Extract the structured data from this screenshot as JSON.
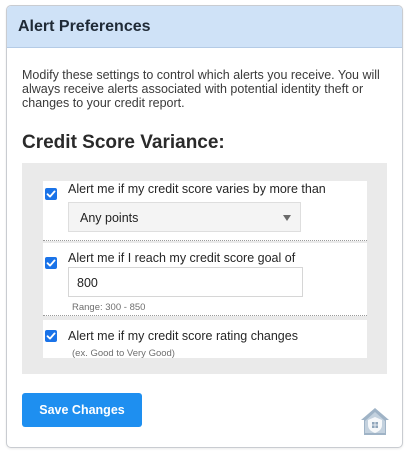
{
  "header": {
    "title": "Alert Preferences"
  },
  "intro": {
    "text": "Modify these settings to control which alerts you receive. You will always receive alerts associated with potential identity theft or changes to your credit report."
  },
  "section": {
    "title": "Credit Score Variance:"
  },
  "alerts": [
    {
      "checked": true,
      "label": "Alert me if my credit score varies by more than",
      "select": {
        "selected": "Any points"
      }
    },
    {
      "checked": true,
      "label": "Alert me if I reach my credit score goal of",
      "input": {
        "value": "800"
      },
      "hint": "Range: 300 - 850"
    },
    {
      "checked": true,
      "label": "Alert me if my credit score rating changes",
      "hint": "(ex. Good to Very Good)"
    }
  ],
  "footer": {
    "save_label": "Save Changes"
  },
  "colors": {
    "header_bg": "#cfe2f7",
    "accent": "#1e8ff0",
    "checkbox": "#1a73e8",
    "panel_bg": "#eaeaea"
  },
  "icons": {
    "logo": "house-shield-logo-icon",
    "checkbox": "checkmark-icon",
    "dropdown": "chevron-down-icon"
  }
}
